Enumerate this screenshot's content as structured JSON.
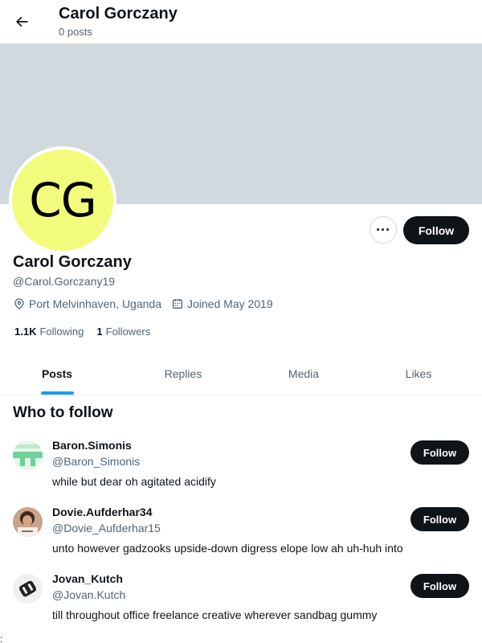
{
  "header": {
    "title": "Carol Gorczany",
    "subtitle": "0 posts"
  },
  "profile": {
    "avatar_initials": "CG",
    "avatar_color": "#f2fb7b",
    "name": "Carol Gorczany",
    "handle": "@Carol.Gorczany19",
    "location": "Port Melvinhaven, Uganda",
    "joined": "Joined May 2019",
    "following_count": "1.1K",
    "following_label": "Following",
    "followers_count": "1",
    "followers_label": "Followers",
    "more_label": "···",
    "follow_label": "Follow"
  },
  "tabs": [
    {
      "label": "Posts",
      "active": true
    },
    {
      "label": "Replies",
      "active": false
    },
    {
      "label": "Media",
      "active": false
    },
    {
      "label": "Likes",
      "active": false
    }
  ],
  "who_to_follow": {
    "title": "Who to follow",
    "items": [
      {
        "name": "Baron.Simonis",
        "handle": "@Baron_Simonis",
        "bio": "while but dear oh agitated acidify",
        "follow_label": "Follow"
      },
      {
        "name": "Dovie.Aufderhar34",
        "handle": "@Dovie_Aufderhar15",
        "bio": "unto however gadzooks upside-down digress elope low ah uh-huh into",
        "follow_label": "Follow"
      },
      {
        "name": "Jovan_Kutch",
        "handle": "@Jovan.Kutch",
        "bio": "till throughout office freelance creative wherever sandbag gummy",
        "follow_label": "Follow"
      }
    ]
  },
  "stray_char": ":",
  "colors": {
    "banner": "#cfd9de",
    "accent": "#1d9bf0",
    "button": "#0f1419",
    "secondary_text": "#536471"
  }
}
